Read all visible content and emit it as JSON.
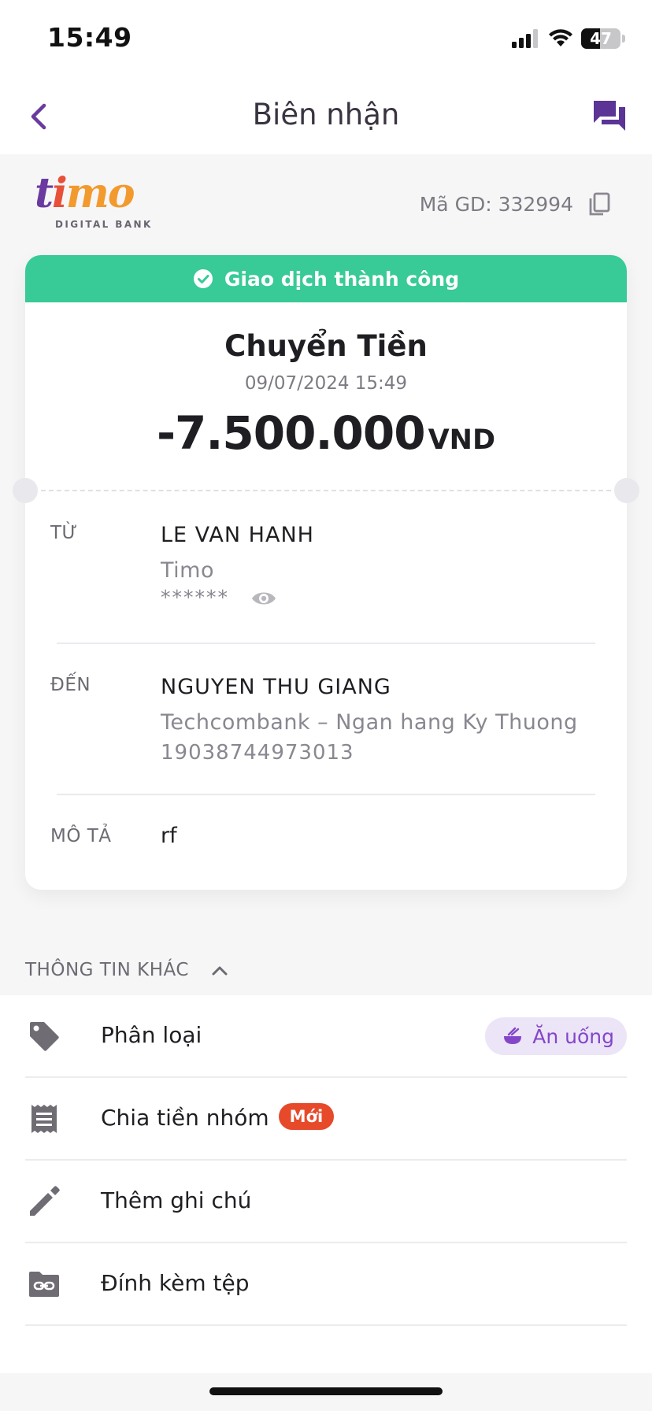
{
  "status_bar": {
    "time": "15:49",
    "battery": "47",
    "battery_level": 0.47
  },
  "nav": {
    "title": "Biên nhận"
  },
  "logo": {
    "wordmark_t": "t",
    "wordmark_i": "i",
    "wordmark_mo": "mo",
    "subtitle": "DIGITAL BANK"
  },
  "transaction_id": "Mã GD: 332994",
  "receipt": {
    "status": "Giao dịch thành công",
    "type": "Chuyển Tiền",
    "datetime": "09/07/2024 15:49",
    "amount": "-7.500.000",
    "currency": "VND"
  },
  "from": {
    "label": "TỪ",
    "name": "LE VAN HANH",
    "bank": "Timo",
    "account_masked": "******"
  },
  "to": {
    "label": "ĐẾN",
    "name": "NGUYEN THU GIANG",
    "bank": "Techcombank – Ngan hang Ky Thuong",
    "account": "19038744973013"
  },
  "description": {
    "label": "MÔ TẢ",
    "value": "rf"
  },
  "other_info": {
    "header": "THÔNG TIN KHÁC",
    "items": [
      {
        "label": "Phân loại",
        "icon": "tag-icon",
        "tag": "Ăn uống"
      },
      {
        "label": "Chia tiền nhóm",
        "icon": "receipt-icon",
        "badge": "Mới"
      },
      {
        "label": "Thêm ghi chú",
        "icon": "pencil-icon"
      },
      {
        "label": "Đính kèm tệp",
        "icon": "folder-link-icon"
      }
    ]
  },
  "colors": {
    "accent": "#6a3aa0",
    "success": "#38ca97",
    "badge": "#e64a2a",
    "tag_bg": "#ece4f7",
    "tag_text": "#8446c9"
  }
}
